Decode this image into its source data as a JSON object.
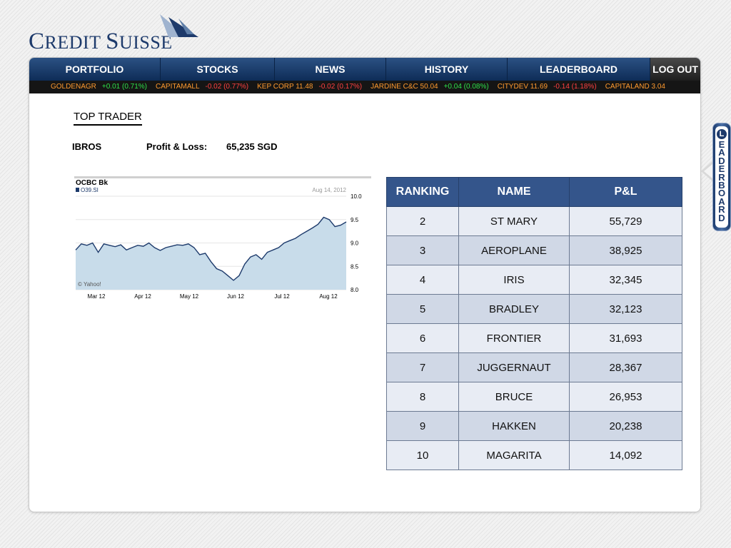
{
  "brand": {
    "name_part1": "C",
    "name_part2": "REDIT ",
    "name_part3": "S",
    "name_part4": "UISSE"
  },
  "nav": {
    "items": [
      "PORTFOLIO",
      "STOCKS",
      "NEWS",
      "HISTORY",
      "LEADERBOARD"
    ],
    "logout_label": "LOG OUT"
  },
  "ticker": [
    {
      "name": "GOLDENAGR",
      "change": "+0.01 (0.71%)",
      "direction": "up"
    },
    {
      "name": "CAPITAMALL",
      "change": "-0.02 (0.77%)",
      "direction": "down"
    },
    {
      "name": "KEP CORP 11.48",
      "change": "-0.02 (0.17%)",
      "direction": "down"
    },
    {
      "name": "JARDINE C&C 50.04",
      "change": "+0.04 (0.08%)",
      "direction": "up"
    },
    {
      "name": "CITYDEV 11.69",
      "change": "-0.14 (1.18%)",
      "direction": "down"
    },
    {
      "name": "CAPITALAND 3.04",
      "change": "",
      "direction": "none"
    }
  ],
  "colors": {
    "up": "#2ee04a",
    "down": "#ff4040",
    "ticker_name": "#ff9a2e",
    "nav": "#1b3f72",
    "table_header": "#34558b"
  },
  "top_trader": {
    "heading": "TOP TRADER",
    "name": "IBROS",
    "pl_label": "Profit & Loss:",
    "pl_value": "65,235 SGD"
  },
  "chart_data": {
    "type": "area",
    "title": "OCBC Bk",
    "symbol": "O39.SI",
    "date_label": "Aug 14, 2012",
    "source": "© Yahoo!",
    "x_ticks": [
      "Mar 12",
      "Apr 12",
      "May 12",
      "Jun 12",
      "Jul 12",
      "Aug 12"
    ],
    "y_ticks": [
      "10.0",
      "9.5",
      "9.0",
      "8.5",
      "8.0"
    ],
    "ylim": [
      8.0,
      10.0
    ],
    "x": [
      "Feb 27",
      "Mar 2",
      "Mar 6",
      "Mar 9",
      "Mar 13",
      "Mar 16",
      "Mar 20",
      "Mar 23",
      "Mar 27",
      "Mar 30",
      "Apr 3",
      "Apr 6",
      "Apr 10",
      "Apr 13",
      "Apr 17",
      "Apr 20",
      "Apr 24",
      "Apr 27",
      "May 1",
      "May 4",
      "May 8",
      "May 11",
      "May 15",
      "May 18",
      "May 22",
      "May 25",
      "May 29",
      "Jun 1",
      "Jun 5",
      "Jun 8",
      "Jun 12",
      "Jun 15",
      "Jun 19",
      "Jun 22",
      "Jun 26",
      "Jun 29",
      "Jul 3",
      "Jul 6",
      "Jul 10",
      "Jul 13",
      "Jul 17",
      "Jul 20",
      "Jul 24",
      "Jul 27",
      "Jul 31",
      "Aug 3",
      "Aug 7",
      "Aug 10",
      "Aug 14"
    ],
    "values": [
      8.85,
      8.98,
      8.95,
      9.0,
      8.8,
      8.98,
      8.95,
      8.92,
      8.96,
      8.85,
      8.9,
      8.95,
      8.93,
      9.0,
      8.9,
      8.84,
      8.9,
      8.93,
      8.96,
      8.95,
      8.98,
      8.9,
      8.75,
      8.78,
      8.6,
      8.45,
      8.4,
      8.3,
      8.2,
      8.3,
      8.55,
      8.7,
      8.75,
      8.65,
      8.8,
      8.85,
      8.9,
      9.0,
      9.05,
      9.1,
      9.18,
      9.25,
      9.32,
      9.4,
      9.55,
      9.5,
      9.35,
      9.38,
      9.45
    ]
  },
  "leaderboard": {
    "headers": [
      "RANKING",
      "NAME",
      "P&L"
    ],
    "rows": [
      {
        "rank": "2",
        "name": "ST MARY",
        "pl": "55,729"
      },
      {
        "rank": "3",
        "name": "AEROPLANE",
        "pl": "38,925"
      },
      {
        "rank": "4",
        "name": "IRIS",
        "pl": "32,345"
      },
      {
        "rank": "5",
        "name": "BRADLEY",
        "pl": "32,123"
      },
      {
        "rank": "6",
        "name": "FRONTIER",
        "pl": "31,693"
      },
      {
        "rank": "7",
        "name": "JUGGERNAUT",
        "pl": "28,367"
      },
      {
        "rank": "8",
        "name": "BRUCE",
        "pl": "26,953"
      },
      {
        "rank": "9",
        "name": "HAKKEN",
        "pl": "20,238"
      },
      {
        "rank": "10",
        "name": "MAGARITA",
        "pl": "14,092"
      }
    ]
  },
  "side_tab": {
    "first_letter": "L",
    "rest": "EADERBOARD"
  }
}
